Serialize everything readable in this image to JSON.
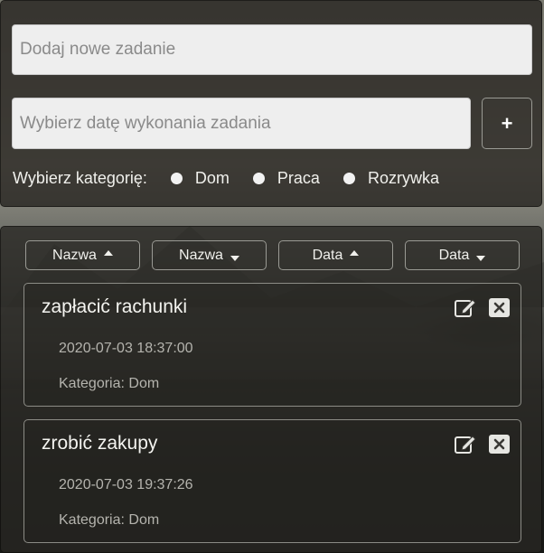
{
  "form": {
    "task_placeholder": "Dodaj nowe zadanie",
    "date_placeholder": "Wybierz datę wykonania zadania",
    "add_button_label": "+",
    "category_label": "Wybierz kategorię:",
    "categories": [
      {
        "label": "Dom"
      },
      {
        "label": "Praca"
      },
      {
        "label": "Rozrywka"
      }
    ]
  },
  "sort_buttons": [
    {
      "label": "Nazwa",
      "direction": "up"
    },
    {
      "label": "Nazwa",
      "direction": "down"
    },
    {
      "label": "Data",
      "direction": "up"
    },
    {
      "label": "Data",
      "direction": "down"
    }
  ],
  "tasks": [
    {
      "title": "zapłacić rachunki",
      "datetime": "2020-07-03 18:37:00",
      "category": "Kategoria: Dom"
    },
    {
      "title": "zrobić zakupy",
      "datetime": "2020-07-03 19:37:26",
      "category": "Kategoria: Dom"
    }
  ],
  "icons": {
    "edit": "edit-icon",
    "delete": "delete-icon"
  },
  "colors": {
    "panel_bg": "#28261f",
    "text": "#f0f0ec",
    "muted_text": "#b5b4ae",
    "input_bg": "#eeeeee"
  }
}
